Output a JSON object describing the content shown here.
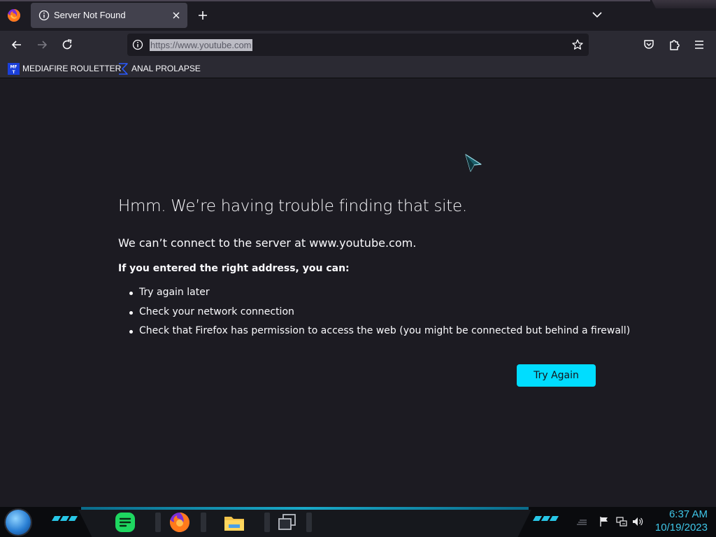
{
  "window": {
    "tab_title": "Server Not Found",
    "url": "https://www.youtube.com"
  },
  "bookmarks": [
    {
      "label": "MEDIAFIRE ROULETTER",
      "icon": "mft-icon"
    },
    {
      "label": "ANAL PROLAPSE",
      "icon": "sigma-icon"
    }
  ],
  "error": {
    "title": "Hmm. We’re having trouble finding that site.",
    "subtitle": "We can’t connect to the server at www.youtube.com.",
    "hint": "If you entered the right address, you can:",
    "suggestions": [
      "Try again later",
      "Check your network connection",
      "Check that Firefox has permission to access the web (you might be connected but behind a firewall)"
    ],
    "button": "Try Again"
  },
  "taskbar": {
    "time": "6:37 AM",
    "date": "10/19/2023"
  },
  "colors": {
    "background": "#1c1b22",
    "toolbar": "#2b2a33",
    "accent": "#00ddff",
    "clock": "#3fc6e8"
  }
}
